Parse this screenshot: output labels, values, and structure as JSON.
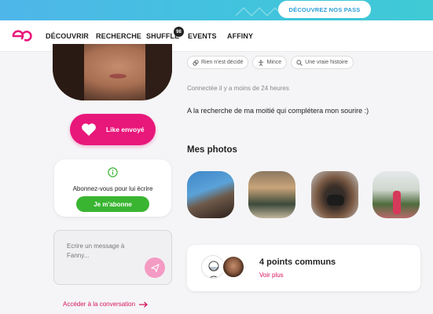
{
  "promo": {
    "button_label": "DÉCOUVREZ NOS PASS"
  },
  "nav": {
    "items": [
      {
        "label": "DÉCOUVRIR"
      },
      {
        "label": "RECHERCHE"
      },
      {
        "label": "SHUFFLE"
      },
      {
        "label": "EVENTS"
      },
      {
        "label": "AFFINY"
      }
    ],
    "shuffle_badge": "98"
  },
  "profile": {
    "like_label": "Like envoyé",
    "subscribe_text": "Abonnez-vous pour lui écrire",
    "subscribe_button": "Je m'abonne",
    "message_placeholder": "Ecrire un message à Fanny...",
    "conversation_link": "Accéder à la conversation",
    "tags": [
      {
        "icon": "ring-icon",
        "label": "Rien n'est décidé"
      },
      {
        "icon": "figure-icon",
        "label": "Mince"
      },
      {
        "icon": "search-icon",
        "label": "Une vraie histoire"
      }
    ],
    "connected": "Connectée il y a moins de 24 heures",
    "quote": "A la recherche de ma moitié qui complétera mon sourire :)",
    "photos_title": "Mes photos",
    "common_title": "4 points communs",
    "common_link": "Voir plus"
  },
  "colors": {
    "accent": "#e8177a",
    "green": "#3ab532",
    "banner": "#4fb6ea"
  }
}
